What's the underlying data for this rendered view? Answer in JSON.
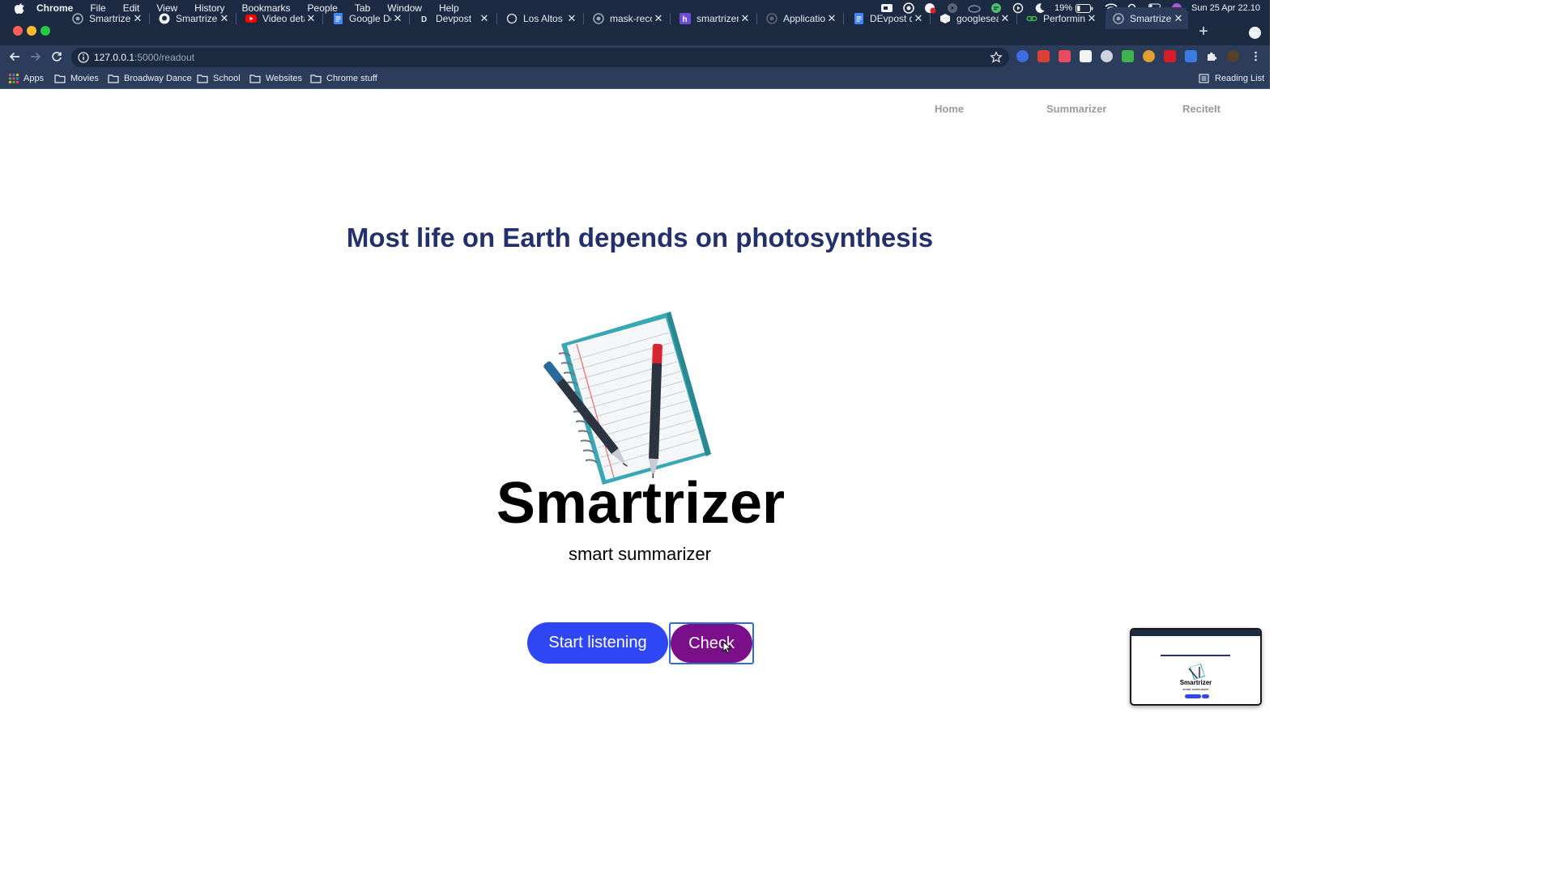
{
  "menubar": {
    "items": [
      "Chrome",
      "File",
      "Edit",
      "View",
      "History",
      "Bookmarks",
      "People",
      "Tab",
      "Window",
      "Help"
    ],
    "battery": "19%",
    "datetime": "Sun 25 Apr  22.10"
  },
  "tabs": [
    {
      "title": "Smartrizer -",
      "icon": "smartrizer-favicon"
    },
    {
      "title": "Smartrizer/",
      "icon": "github-icon"
    },
    {
      "title": "Video detail",
      "icon": "youtube-icon"
    },
    {
      "title": "Google Doc",
      "icon": "google-docs-icon"
    },
    {
      "title": "Devpost",
      "icon": "devpost-icon"
    },
    {
      "title": "Los Altos H",
      "icon": "circle-favicon"
    },
    {
      "title": "mask-recog",
      "icon": "smartrizer-favicon"
    },
    {
      "title": "smartrizer",
      "icon": "hackerearth-icon"
    },
    {
      "title": "Application",
      "icon": "globe-icon"
    },
    {
      "title": "DEvpost de",
      "icon": "google-docs-icon"
    },
    {
      "title": "googlesear",
      "icon": "cube-icon"
    },
    {
      "title": "Performing",
      "icon": "link-icon"
    },
    {
      "title": "Smartrizer",
      "icon": "smartrizer-favicon",
      "active": true
    }
  ],
  "address_bar": {
    "host": "127.0.0.1",
    "rest": ":5000/readout"
  },
  "bookmarks": {
    "items": [
      "Apps",
      "Movies",
      "Broadway Dance",
      "School",
      "Websites",
      "Chrome stuff"
    ],
    "reading_list": "Reading List"
  },
  "page": {
    "nav": [
      "Home",
      "Summarizer",
      "ReciteIt"
    ],
    "headline": "Most life on Earth depends on photosynthesis",
    "brand": "Smartrizer",
    "tagline": "smart summarizer",
    "start_button": "Start listening",
    "check_button": "Check"
  },
  "thumbnail": {
    "brand": "Smartrizer",
    "tagline": "smart summarizer"
  },
  "colors": {
    "headline": "#22306e",
    "start_button": "#2f46f5",
    "check_button": "#7b0f8a",
    "chrome_frame": "#1b2941"
  }
}
